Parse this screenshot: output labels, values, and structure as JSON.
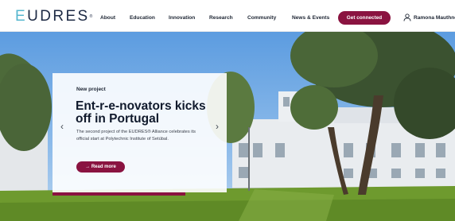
{
  "brand": {
    "logo_first": "E",
    "logo_rest": "UDRES",
    "logo_mark": "®"
  },
  "nav": {
    "items": [
      "About",
      "Education",
      "Innovation",
      "Research",
      "Community",
      "News & Events"
    ],
    "cta": "Get connected",
    "user_name": "Ramona Mauthner"
  },
  "hero": {
    "eyebrow": "New project",
    "title": "Ent-r-e-novators kicks off in Portugal",
    "description": "The second project of the EUDRES® Alliance celebrates its official start at Polytechnic Institute of Setúbal.",
    "read_more": "→ Read more",
    "prev_arrow": "‹",
    "next_arrow": "›"
  },
  "colors": {
    "accent": "#8a1340",
    "logo_accent": "#56b7cf",
    "text_dark": "#1d2533"
  },
  "icons": {
    "user": "user-icon",
    "prev": "chevron-left-icon",
    "next": "chevron-right-icon"
  }
}
